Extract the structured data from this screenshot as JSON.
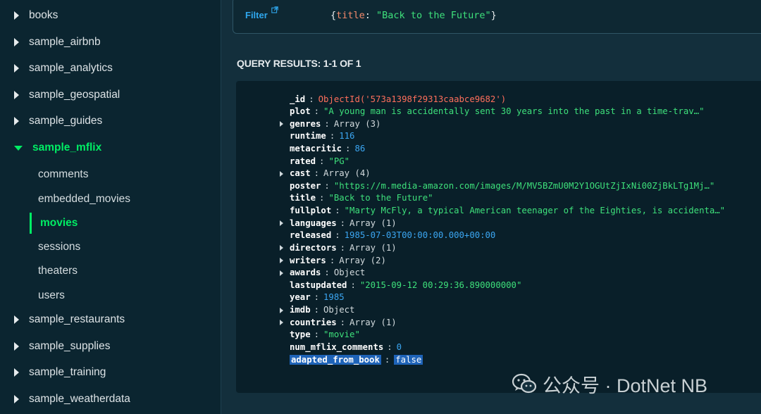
{
  "sidebar": {
    "databases": [
      {
        "name": "books"
      },
      {
        "name": "sample_airbnb"
      },
      {
        "name": "sample_analytics"
      },
      {
        "name": "sample_geospatial"
      },
      {
        "name": "sample_guides"
      },
      {
        "name": "sample_mflix",
        "expanded": true
      },
      {
        "name": "sample_restaurants"
      },
      {
        "name": "sample_supplies"
      },
      {
        "name": "sample_training"
      },
      {
        "name": "sample_weatherdata"
      }
    ],
    "collections": [
      {
        "name": "comments"
      },
      {
        "name": "embedded_movies"
      },
      {
        "name": "movies",
        "selected": true
      },
      {
        "name": "sessions"
      },
      {
        "name": "theaters"
      },
      {
        "name": "users"
      }
    ]
  },
  "filter": {
    "label": "Filter",
    "query_open": "{",
    "query_key": "title",
    "query_colon": ": ",
    "query_value": "\"Back to the Future\"",
    "query_close": "}"
  },
  "results": {
    "title": "QUERY RESULTS: 1-1 OF 1"
  },
  "document": {
    "fields": [
      {
        "key": "_id",
        "value": "ObjectId('573a1398f29313caabce9682')",
        "type": "objid"
      },
      {
        "key": "plot",
        "value": "\"A young man is accidentally sent 30 years into the past in a time-trav…\"",
        "type": "string"
      },
      {
        "key": "genres",
        "value": "Array (3)",
        "type": "type",
        "expandable": true
      },
      {
        "key": "runtime",
        "value": "116",
        "type": "number"
      },
      {
        "key": "metacritic",
        "value": "86",
        "type": "number"
      },
      {
        "key": "rated",
        "value": "\"PG\"",
        "type": "string"
      },
      {
        "key": "cast",
        "value": "Array (4)",
        "type": "type",
        "expandable": true
      },
      {
        "key": "poster",
        "value": "\"https://m.media-amazon.com/images/M/MV5BZmU0M2Y1OGUtZjIxNi00ZjBkLTg1Mj…\"",
        "type": "string"
      },
      {
        "key": "title",
        "value": "\"Back to the Future\"",
        "type": "string"
      },
      {
        "key": "fullplot",
        "value": "\"Marty McFly, a typical American teenager of the Eighties, is accidenta…\"",
        "type": "string"
      },
      {
        "key": "languages",
        "value": "Array (1)",
        "type": "type",
        "expandable": true
      },
      {
        "key": "released",
        "value": "1985-07-03T00:00:00.000+00:00",
        "type": "date"
      },
      {
        "key": "directors",
        "value": "Array (1)",
        "type": "type",
        "expandable": true
      },
      {
        "key": "writers",
        "value": "Array (2)",
        "type": "type",
        "expandable": true
      },
      {
        "key": "awards",
        "value": "Object",
        "type": "type",
        "expandable": true
      },
      {
        "key": "lastupdated",
        "value": "\"2015-09-12 00:29:36.890000000\"",
        "type": "string"
      },
      {
        "key": "year",
        "value": "1985",
        "type": "number"
      },
      {
        "key": "imdb",
        "value": "Object",
        "type": "type",
        "expandable": true
      },
      {
        "key": "countries",
        "value": "Array (1)",
        "type": "type",
        "expandable": true
      },
      {
        "key": "type",
        "value": "\"movie\"",
        "type": "string"
      },
      {
        "key": "num_mflix_comments",
        "value": "0",
        "type": "number"
      },
      {
        "key": "adapted_from_book",
        "value": "false",
        "type": "bool",
        "highlighted": true
      }
    ]
  },
  "watermark": {
    "text": "公众号 · DotNet NB"
  },
  "colors": {
    "accent": "#00ed64",
    "link": "#2fa7ee",
    "string": "#3ee07b",
    "number": "#3ba6f2",
    "objectid": "#ff6f5c"
  }
}
